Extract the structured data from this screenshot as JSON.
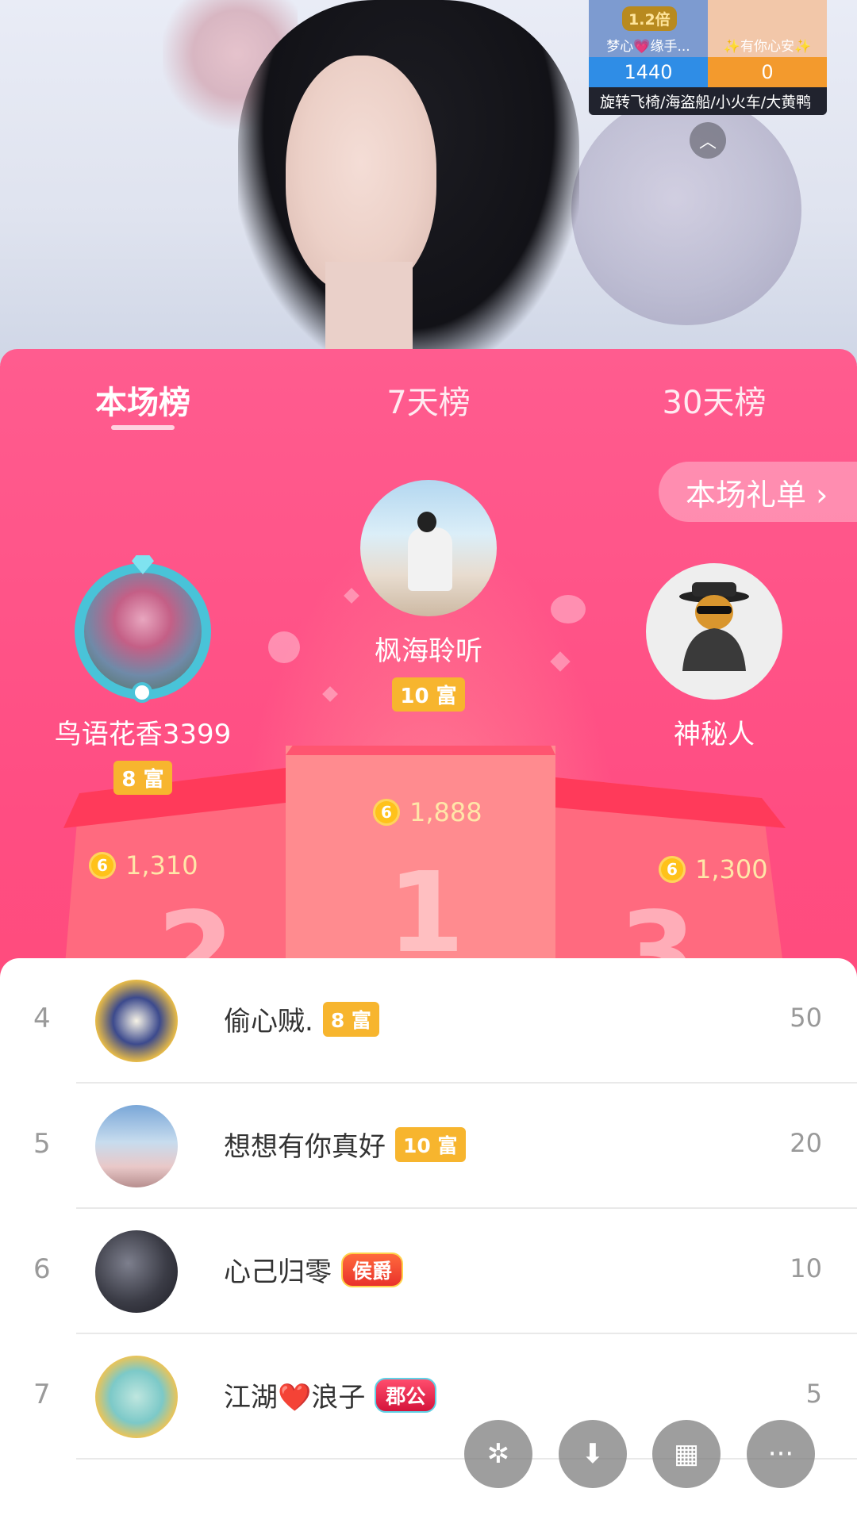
{
  "pk": {
    "multiplier": "1.2倍",
    "left_name": "梦心💗缘手...",
    "right_name": "✨有你心安✨",
    "left_score": "1440",
    "right_score": "0",
    "gifts": "旋转飞椅/海盗船/小火车/大黄鸭"
  },
  "tabs": [
    {
      "label": "本场榜",
      "active": true
    },
    {
      "label": "7天榜",
      "active": false
    },
    {
      "label": "30天榜",
      "active": false
    }
  ],
  "gift_list_button": "本场礼单 ›",
  "top3": {
    "first": {
      "name": "枫海聆听",
      "rich": "10 富",
      "coins": "1,888",
      "place": "1"
    },
    "second": {
      "name": "鸟语花香3399",
      "rich": "8 富",
      "coins": "1,310",
      "place": "2"
    },
    "third": {
      "name": "神秘人",
      "coins": "1,300",
      "place": "3"
    }
  },
  "coin_symbol": "6",
  "list": [
    {
      "rank": "4",
      "name": "偷心贼.",
      "badge": "8 富",
      "badge_type": "rich",
      "value": "50"
    },
    {
      "rank": "5",
      "name": "想想有你真好",
      "badge": "10 富",
      "badge_type": "rich",
      "value": "20"
    },
    {
      "rank": "6",
      "name": "心己归零",
      "badge": "侯爵",
      "badge_type": "noble",
      "value": "10"
    },
    {
      "rank": "7",
      "name": "江湖❤️浪子",
      "badge": "郡公",
      "badge_type": "duke",
      "value": "5"
    }
  ],
  "fab": {
    "share_icon": "✲",
    "download_icon": "⬇",
    "grid_icon": "▦",
    "more_icon": "···"
  },
  "colors": {
    "panel_top": "#ff5c8f",
    "panel_bottom": "#ff4a6d",
    "rich_badge": "#f7b52e",
    "coin_value": "#ffe6a8"
  }
}
